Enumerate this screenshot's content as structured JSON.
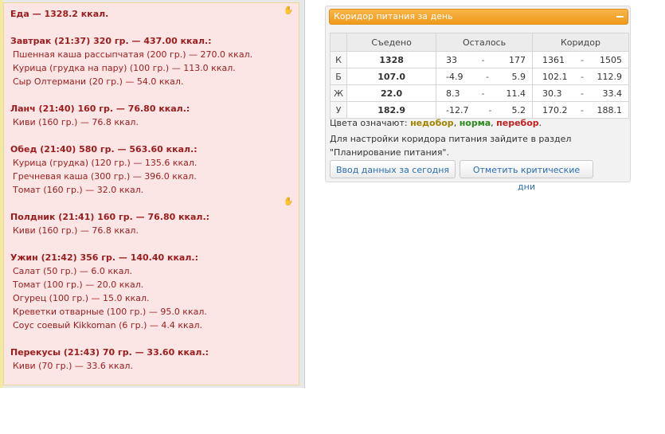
{
  "food_log": {
    "lines": [
      {
        "type": "title",
        "text": "Еда — 1328.2 ккал."
      },
      {
        "type": "blank",
        "text": ""
      },
      {
        "type": "meal",
        "text": "Завтрак (21:37) 320 гр. — 437.00 ккал.:"
      },
      {
        "type": "item",
        "text": "Пшенная каша рассыпчатая (200 гр.) — 270.0 ккал."
      },
      {
        "type": "item",
        "text": "Курица (грудка на пару) (100 гр.) — 113.0 ккал."
      },
      {
        "type": "item",
        "text": "Сыр Олтермани (20 гр.) — 54.0 ккал."
      },
      {
        "type": "blank",
        "text": ""
      },
      {
        "type": "meal",
        "text": "Ланч (21:40) 160 гр. — 76.80 ккал.:"
      },
      {
        "type": "item",
        "text": "Киви (160 гр.) — 76.8 ккал."
      },
      {
        "type": "blank",
        "text": ""
      },
      {
        "type": "meal",
        "text": "Обед (21:40) 580 гр. — 563.60 ккал.:"
      },
      {
        "type": "item",
        "text": "Курица (грудка) (120 гр.) — 135.6 ккал."
      },
      {
        "type": "item",
        "text": "Гречневая каша (300 гр.) — 396.0 ккал."
      },
      {
        "type": "item",
        "text": "Томат (160 гр.) — 32.0 ккал."
      },
      {
        "type": "blank",
        "text": ""
      },
      {
        "type": "meal",
        "text": "Полдник (21:41) 160 гр. — 76.80 ккал.:"
      },
      {
        "type": "item",
        "text": "Киви (160 гр.) — 76.8 ккал."
      },
      {
        "type": "blank",
        "text": ""
      },
      {
        "type": "meal",
        "text": "Ужин (21:42) 356 гр. — 140.40 ккал.:"
      },
      {
        "type": "item",
        "text": "Салат (50 гр.) — 6.0 ккал."
      },
      {
        "type": "item",
        "text": "Томат (100 гр.) — 20.0 ккал."
      },
      {
        "type": "item",
        "text": "Огурец (100 гр.) — 15.0 ккал."
      },
      {
        "type": "item",
        "text": "Креветки отварные (100 гр.) — 95.0 ккал."
      },
      {
        "type": "item",
        "text": "Соус соевый Kikkoman (6 гр.) — 4.4 ккал."
      },
      {
        "type": "blank",
        "text": ""
      },
      {
        "type": "meal",
        "text": "Перекусы (21:43) 70 гр. — 33.60 ккал.:"
      },
      {
        "type": "item",
        "text": "Киви (70 гр.) — 33.6 ккал."
      }
    ]
  },
  "corridor": {
    "header": "Коридор питания за день",
    "columns": [
      "Съедено",
      "Осталось",
      "Коридор"
    ],
    "rows": [
      {
        "label": "К",
        "eaten": "1328",
        "eaten_status": "under",
        "left_min": "33",
        "left_max": "177",
        "corr_min": "1361",
        "corr_max": "1505"
      },
      {
        "label": "Б",
        "eaten": "107.0",
        "eaten_status": "norm",
        "left_min": "-4.9",
        "left_max": "5.9",
        "corr_min": "102.1",
        "corr_max": "112.9"
      },
      {
        "label": "Ж",
        "eaten": "22.0",
        "eaten_status": "under",
        "left_min": "8.3",
        "left_max": "11.4",
        "corr_min": "30.3",
        "corr_max": "33.4"
      },
      {
        "label": "У",
        "eaten": "182.9",
        "eaten_status": "norm",
        "left_min": "-12.7",
        "left_max": "5.2",
        "corr_min": "170.2",
        "corr_max": "188.1"
      }
    ],
    "dash": "-",
    "legend": {
      "prefix": "Цвета означают:",
      "under": "недобор",
      "sep1": ",",
      "norm": "норма",
      "sep2": ",",
      "over": "перебор",
      "end": "."
    },
    "settings_note": "Для настройки коридора питания зайдите в раздел \"Планирование питания\".",
    "buttons": {
      "today": "Ввод данных за сегодня",
      "critical": "Отметить критические дни"
    },
    "colors": {
      "under": "#b29b00",
      "norm": "#2b8a1c",
      "over": "#c21f1f",
      "header": "#f4a42c"
    }
  }
}
